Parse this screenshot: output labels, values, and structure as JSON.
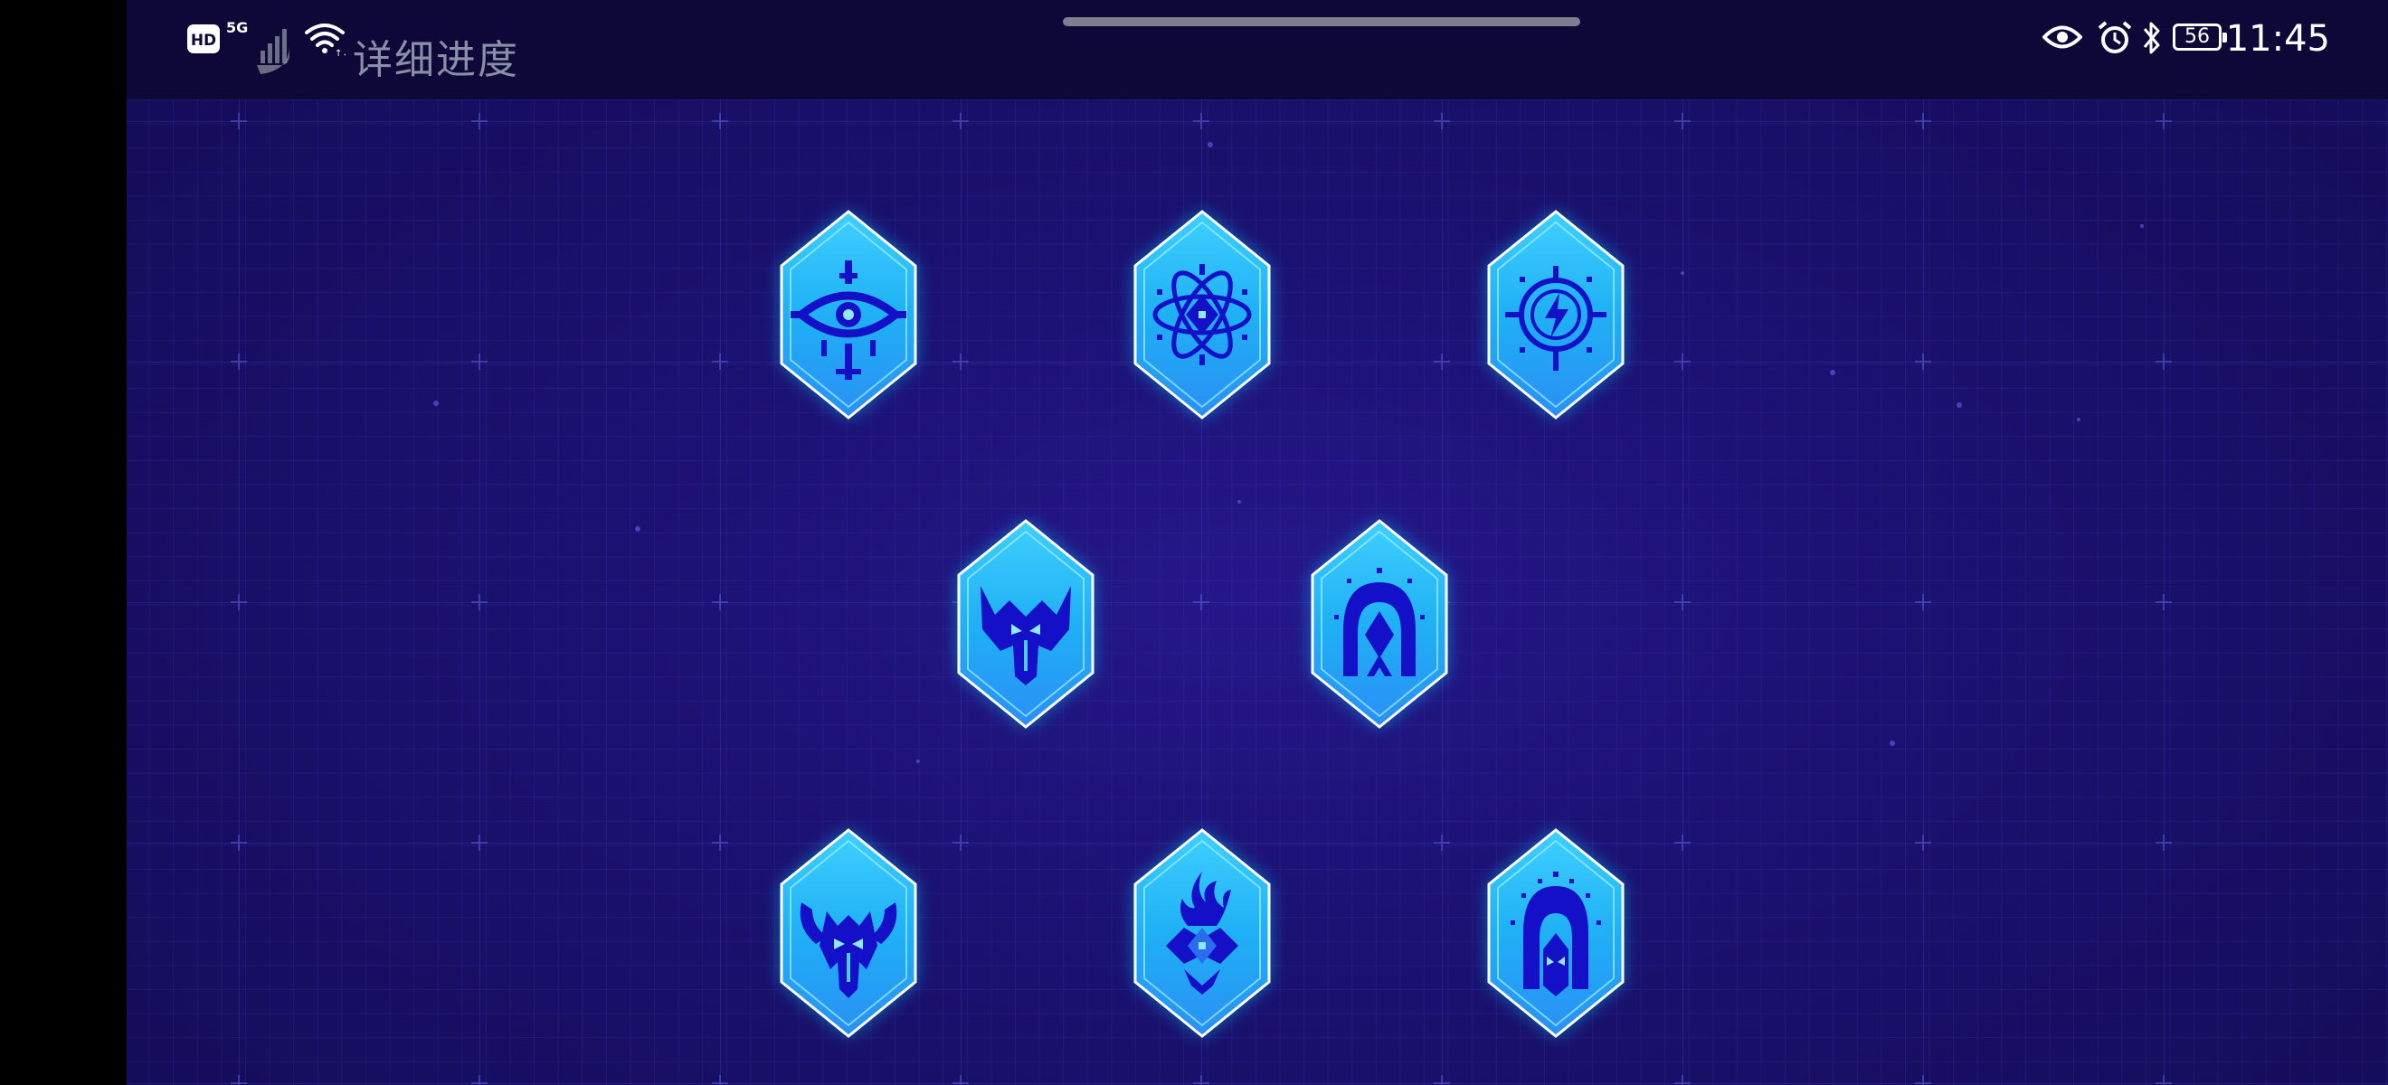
{
  "status_bar": {
    "title": "详细进度",
    "time": "11:45",
    "battery_level": "56",
    "network_type": "5G",
    "hd_label": "HD",
    "icons": [
      "hd-icon",
      "5g-signal-icon",
      "wifi-icon",
      "eye-comfort-icon",
      "alarm-icon",
      "bluetooth-icon",
      "battery-icon"
    ]
  },
  "colors": {
    "background": "#1b1172",
    "grid": "#4646c8",
    "badge_fill": "#1fb0f5",
    "badge_glow": "#00c8ff",
    "badge_border": "#ffffff",
    "symbol": "#1410c8"
  },
  "badges": [
    {
      "id": "eye",
      "icon": "eye-emblem-icon"
    },
    {
      "id": "atom",
      "icon": "atom-emblem-icon"
    },
    {
      "id": "bolt",
      "icon": "lightning-emblem-icon"
    },
    {
      "id": "horned-helm",
      "icon": "horned-helmet-emblem-icon"
    },
    {
      "id": "arch",
      "icon": "arch-emblem-icon"
    },
    {
      "id": "horned-demon",
      "icon": "horned-demon-emblem-icon"
    },
    {
      "id": "flame",
      "icon": "flame-emblem-icon"
    },
    {
      "id": "mask",
      "icon": "mask-emblem-icon"
    }
  ]
}
